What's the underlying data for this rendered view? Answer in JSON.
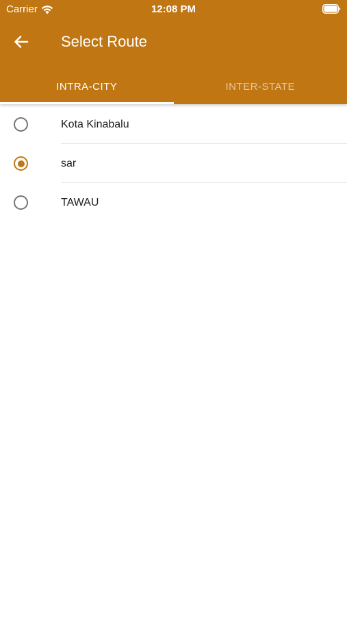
{
  "status_bar": {
    "carrier": "Carrier",
    "time": "12:08 PM"
  },
  "header": {
    "title": "Select Route",
    "back_icon": "arrow-back-icon"
  },
  "tabs": [
    {
      "label": "INTRA-CITY",
      "active": true
    },
    {
      "label": "INTER-STATE",
      "active": false
    }
  ],
  "routes": [
    {
      "label": "Kota Kinabalu",
      "selected": false
    },
    {
      "label": "sar",
      "selected": true
    },
    {
      "label": "TAWAU",
      "selected": false
    }
  ],
  "colors": {
    "primary": "#c07613",
    "on_primary": "#ffffff",
    "radio_unselected": "#757575",
    "text": "#212121",
    "divider": "#e6e6e6"
  }
}
